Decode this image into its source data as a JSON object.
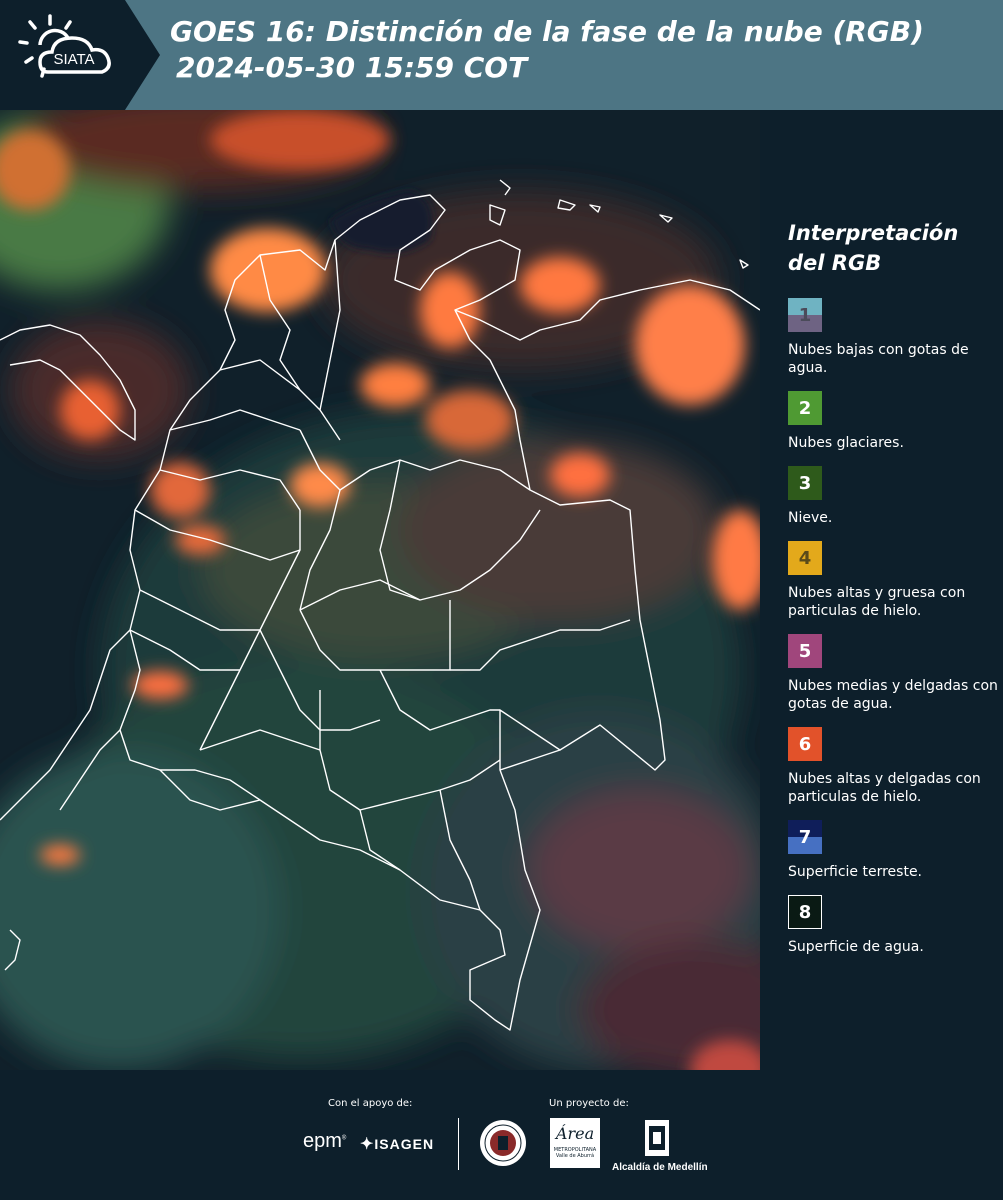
{
  "header": {
    "title_line1": "GOES 16: Distinción de la fase de la nube (RGB)",
    "title_line2": "2024-05-30 15:59 COT",
    "logo_text": "SIATA"
  },
  "legend": {
    "title": "Interpretación del RGB",
    "items": [
      {
        "number": "1",
        "label": "Nubes bajas con gotas de agua.",
        "color_top": "#6fb3c2",
        "color_bottom": "#6e6383",
        "text_color": "#4b4b5a"
      },
      {
        "number": "2",
        "label": "Nubes glaciares.",
        "color_top": "#4f9a33",
        "color_bottom": "#4f9a33",
        "text_color": "#ffffff"
      },
      {
        "number": "3",
        "label": "Nieve.",
        "color_top": "#2e5a1b",
        "color_bottom": "#2e5a1b",
        "text_color": "#ffffff"
      },
      {
        "number": "4",
        "label": "Nubes altas y gruesa con particulas de hielo.",
        "color_top": "#e3a91b",
        "color_bottom": "#e3a91b",
        "text_color": "#5a4a1a"
      },
      {
        "number": "5",
        "label": "Nubes medias y delgadas con gotas de agua.",
        "color_top": "#a0467c",
        "color_bottom": "#a0467c",
        "text_color": "#ffffff"
      },
      {
        "number": "6",
        "label": "Nubes altas y delgadas con particulas de hielo.",
        "color_top": "#e2522a",
        "color_bottom": "#e2522a",
        "text_color": "#ffffff"
      },
      {
        "number": "7",
        "label": "Superficie terreste.",
        "color_top": "#0f1e5a",
        "color_bottom": "#4670c2",
        "text_color": "#ffffff"
      },
      {
        "number": "8",
        "label": "Superficie de agua.",
        "color_top": "#0a1a14",
        "color_bottom": "#0a1a14",
        "text_color": "#ffffff"
      }
    ]
  },
  "footer": {
    "support_label": "Con el apoyo de:",
    "project_label": "Un proyecto de:",
    "epm_text": "epm",
    "isagen_text": "ISAGEN",
    "area_text": "Área",
    "area_subtext": "METROPOLITANA",
    "area_subtext2": "Valle de Aburrá",
    "alcaldia_text": "Alcaldía de Medellín"
  },
  "colors": {
    "background": "#0d1f2b",
    "header_band": "#4d7584",
    "cloud_orange": "#ff7a3c",
    "border_white": "#ffffff"
  }
}
